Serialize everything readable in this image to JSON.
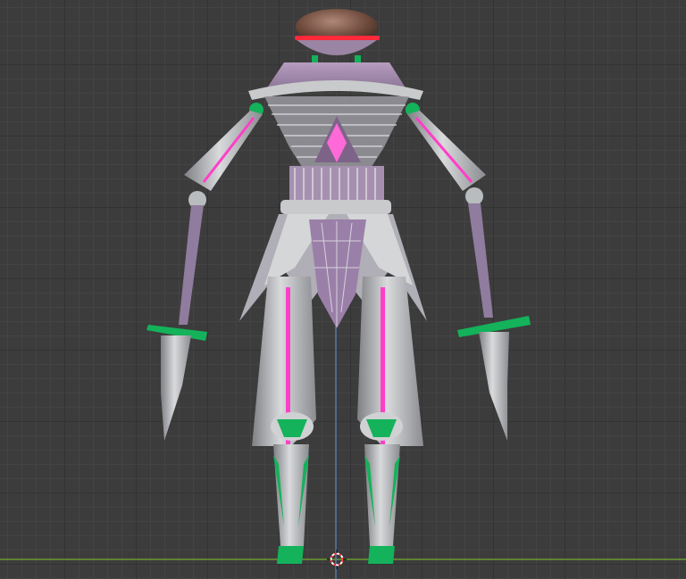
{
  "viewport": {
    "grid": true,
    "axes": {
      "x_axis_color": "#6d9a2e",
      "z_axis_color": "#5a82c8"
    }
  },
  "scene": {
    "palette": {
      "metal": "#c4c6c8",
      "metal_dark": "#8c8e92",
      "lavender": "#a892b0",
      "pink": "#ff3fc8",
      "green": "#14b25a",
      "red": "#ff2a3a",
      "dome": "#7a5646"
    },
    "icons": [
      "origin-cursor-icon"
    ]
  }
}
